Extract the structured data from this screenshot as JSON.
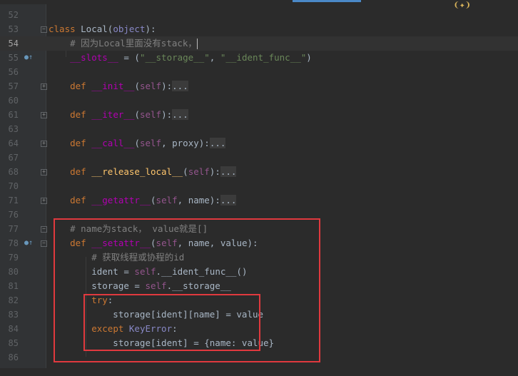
{
  "editor": {
    "active_line": "54",
    "lines": [
      {
        "n": "52",
        "tokens": []
      },
      {
        "n": "53",
        "tokens": [
          {
            "t": "class ",
            "c": "kw"
          },
          {
            "t": "Local",
            "c": ""
          },
          {
            "t": "(",
            "c": ""
          },
          {
            "t": "object",
            "c": "builtin"
          },
          {
            "t": "):",
            "c": ""
          }
        ]
      },
      {
        "n": "54",
        "tokens": [
          {
            "t": "    ",
            "c": ""
          },
          {
            "t": "# 因为Local里面没有stack，",
            "c": "cm"
          }
        ]
      },
      {
        "n": "55",
        "tokens": [
          {
            "t": "    ",
            "c": ""
          },
          {
            "t": "__slots__",
            "c": "dund"
          },
          {
            "t": " = (",
            "c": ""
          },
          {
            "t": "\"__storage__\"",
            "c": "str"
          },
          {
            "t": ", ",
            "c": ""
          },
          {
            "t": "\"__ident_func__\"",
            "c": "str"
          },
          {
            "t": ")",
            "c": ""
          }
        ]
      },
      {
        "n": "56",
        "tokens": []
      },
      {
        "n": "57",
        "tokens": [
          {
            "t": "    ",
            "c": ""
          },
          {
            "t": "def ",
            "c": "kw"
          },
          {
            "t": "__init__",
            "c": "dund"
          },
          {
            "t": "(",
            "c": ""
          },
          {
            "t": "self",
            "c": "self"
          },
          {
            "t": "):",
            "c": ""
          },
          {
            "t": "...",
            "c": "fold-ph"
          }
        ]
      },
      {
        "n": "60",
        "tokens": []
      },
      {
        "n": "61",
        "tokens": [
          {
            "t": "    ",
            "c": ""
          },
          {
            "t": "def ",
            "c": "kw"
          },
          {
            "t": "__iter__",
            "c": "dund"
          },
          {
            "t": "(",
            "c": ""
          },
          {
            "t": "self",
            "c": "self"
          },
          {
            "t": "):",
            "c": ""
          },
          {
            "t": "...",
            "c": "fold-ph"
          }
        ]
      },
      {
        "n": "63",
        "tokens": []
      },
      {
        "n": "64",
        "tokens": [
          {
            "t": "    ",
            "c": ""
          },
          {
            "t": "def ",
            "c": "kw"
          },
          {
            "t": "__call__",
            "c": "dund"
          },
          {
            "t": "(",
            "c": ""
          },
          {
            "t": "self",
            "c": "self"
          },
          {
            "t": ", proxy):",
            "c": ""
          },
          {
            "t": "...",
            "c": "fold-ph"
          }
        ]
      },
      {
        "n": "67",
        "tokens": []
      },
      {
        "n": "68",
        "tokens": [
          {
            "t": "    ",
            "c": ""
          },
          {
            "t": "def ",
            "c": "kw"
          },
          {
            "t": "__release_local__",
            "c": "fn"
          },
          {
            "t": "(",
            "c": ""
          },
          {
            "t": "self",
            "c": "self"
          },
          {
            "t": "):",
            "c": ""
          },
          {
            "t": "...",
            "c": "fold-ph"
          }
        ]
      },
      {
        "n": "70",
        "tokens": []
      },
      {
        "n": "71",
        "tokens": [
          {
            "t": "    ",
            "c": ""
          },
          {
            "t": "def ",
            "c": "kw"
          },
          {
            "t": "__getattr__",
            "c": "dund"
          },
          {
            "t": "(",
            "c": ""
          },
          {
            "t": "self",
            "c": "self"
          },
          {
            "t": ", name):",
            "c": ""
          },
          {
            "t": "...",
            "c": "fold-ph"
          }
        ]
      },
      {
        "n": "76",
        "tokens": []
      },
      {
        "n": "77",
        "tokens": [
          {
            "t": "    ",
            "c": ""
          },
          {
            "t": "# name为stack， value就是[]",
            "c": "cm"
          }
        ]
      },
      {
        "n": "78",
        "tokens": [
          {
            "t": "    ",
            "c": ""
          },
          {
            "t": "def ",
            "c": "kw"
          },
          {
            "t": "__setattr__",
            "c": "dund"
          },
          {
            "t": "(",
            "c": ""
          },
          {
            "t": "self",
            "c": "self"
          },
          {
            "t": ", name, value):",
            "c": ""
          }
        ]
      },
      {
        "n": "79",
        "tokens": [
          {
            "t": "        ",
            "c": ""
          },
          {
            "t": "# 获取线程或协程的id",
            "c": "cm"
          }
        ]
      },
      {
        "n": "80",
        "tokens": [
          {
            "t": "        ident = ",
            "c": ""
          },
          {
            "t": "self",
            "c": "self"
          },
          {
            "t": ".__ident_func__()",
            "c": ""
          }
        ]
      },
      {
        "n": "81",
        "tokens": [
          {
            "t": "        storage = ",
            "c": ""
          },
          {
            "t": "self",
            "c": "self"
          },
          {
            "t": ".__storage__",
            "c": ""
          }
        ]
      },
      {
        "n": "82",
        "tokens": [
          {
            "t": "        ",
            "c": ""
          },
          {
            "t": "try",
            "c": "kw"
          },
          {
            "t": ":",
            "c": ""
          }
        ]
      },
      {
        "n": "83",
        "tokens": [
          {
            "t": "            storage[ident][name] = value",
            "c": ""
          }
        ]
      },
      {
        "n": "84",
        "tokens": [
          {
            "t": "        ",
            "c": ""
          },
          {
            "t": "except ",
            "c": "kw"
          },
          {
            "t": "KeyError",
            "c": "builtin"
          },
          {
            "t": ":",
            "c": ""
          }
        ]
      },
      {
        "n": "85",
        "tokens": [
          {
            "t": "            storage[ident] = {name: value}",
            "c": ""
          }
        ]
      },
      {
        "n": "86",
        "tokens": []
      }
    ]
  },
  "gutter_icons": [
    {
      "line": "55",
      "name": "override-marker-icon",
      "glyph": "●↑"
    },
    {
      "line": "78",
      "name": "override-marker-icon",
      "glyph": "●↑"
    }
  ],
  "colors": {
    "background": "#2b2b2b",
    "highlight_box": "#e0393e",
    "keyword": "#cc7832",
    "comment": "#808080",
    "string": "#6a8759",
    "dunder": "#b200b2",
    "self": "#94558d"
  }
}
